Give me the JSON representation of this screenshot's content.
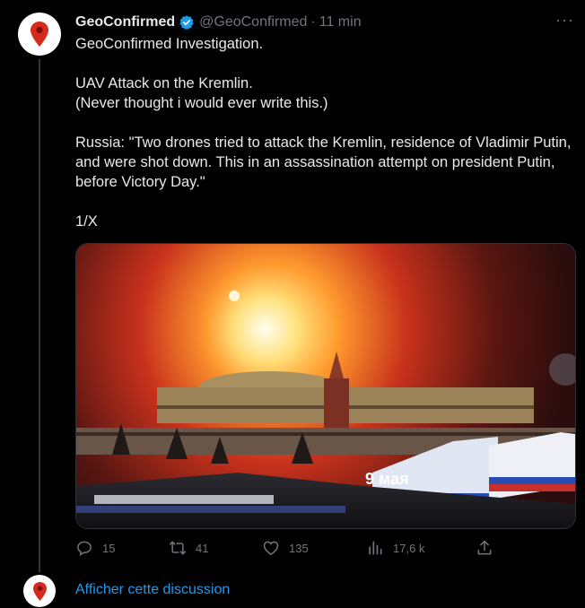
{
  "tweet": {
    "author_name": "GeoConfirmed",
    "handle": "@GeoConfirmed",
    "separator": "·",
    "time": "11 min",
    "more_label": "···",
    "lines": [
      "GeoConfirmed Investigation.",
      "UAV Attack on the Kremlin.",
      "(Never thought i would ever write this.)",
      "Russia: \"Two drones tried to attack the Kremlin, residence of Vladimir Putin, and were shot down. This in an assassination attempt on president Putin, before Victory Day.\"",
      "1/X"
    ],
    "media_caption": "9 мая"
  },
  "actions": {
    "replies": "15",
    "retweets": "41",
    "likes": "135",
    "views": "17,6 k"
  },
  "show_thread_label": "Afficher cette discussion",
  "colors": {
    "accent": "#1d9bf0",
    "muted": "#71767b",
    "background": "#000000",
    "avatar_pin": "#d62a1e"
  }
}
